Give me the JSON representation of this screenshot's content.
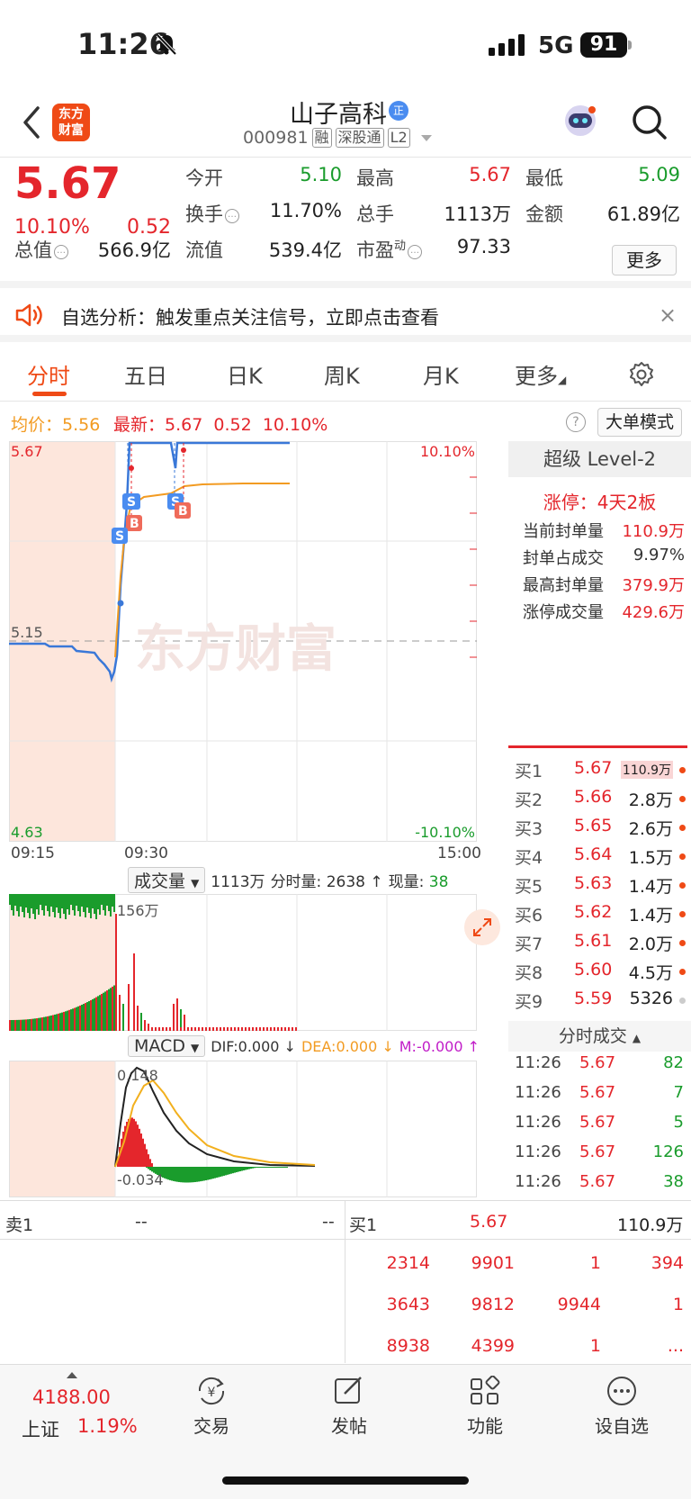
{
  "status": {
    "time": "11:26",
    "network": "5G",
    "battery": "91"
  },
  "header": {
    "logo": [
      "东方",
      "财富"
    ],
    "stock_name": "山子高科",
    "badge": "正",
    "code": "000981",
    "tags": [
      "融",
      "深股通",
      "L2"
    ]
  },
  "quote": {
    "price": "5.67",
    "change_pct": "10.10%",
    "change_amt": "0.52",
    "open_label": "今开",
    "open": "5.10",
    "high_label": "最高",
    "high": "5.67",
    "low_label": "最低",
    "low": "5.09",
    "turnover_label": "换手",
    "turnover": "11.70%",
    "volume_label": "总手",
    "volume": "1113万",
    "amount_label": "金额",
    "amount": "61.89亿",
    "mktcap_label": "总值",
    "mktcap": "566.9亿",
    "float_label": "流值",
    "float": "539.4亿",
    "pe_label": "市盈",
    "pe_sup": "动",
    "pe": "97.33",
    "more": "更多"
  },
  "notice": {
    "text": "自选分析：触发重点关注信号，立即点击查看",
    "close": "×"
  },
  "tabs": [
    "分时",
    "五日",
    "日K",
    "周K",
    "月K",
    "更多"
  ],
  "avg_row": {
    "avg_label": "均价：",
    "avg": "5.56",
    "latest_label": "最新：",
    "latest": "5.67",
    "latest_chg": "0.52",
    "latest_pct": "10.10%",
    "help": "?",
    "bigorder": "大单模式"
  },
  "chart_labels": {
    "top_price": "5.67",
    "top_pct": "10.10%",
    "mid_price": "5.15",
    "bottom_price": "4.63",
    "bottom_pct": "-10.10%",
    "times": [
      "09:15",
      "09:30",
      "15:00"
    ],
    "watermark": "东方财富",
    "marker_s": "S",
    "marker_b": "B"
  },
  "level2": {
    "title": "超级 Level-2",
    "limitup": "涨停：4天2板",
    "rows": [
      {
        "label": "当前封单量",
        "value": "110.9万",
        "color": "#e4262c"
      },
      {
        "label": "封单占成交",
        "value": "9.97%",
        "color": "#222"
      },
      {
        "label": "最高封单量",
        "value": "379.9万",
        "color": "#e4262c"
      },
      {
        "label": "涨停成交量",
        "value": "429.6万",
        "color": "#e4262c"
      }
    ]
  },
  "bids": [
    {
      "label": "买1",
      "price": "5.67",
      "vol": "110.9万"
    },
    {
      "label": "买2",
      "price": "5.66",
      "vol": "2.8万"
    },
    {
      "label": "买3",
      "price": "5.65",
      "vol": "2.6万"
    },
    {
      "label": "买4",
      "price": "5.64",
      "vol": "1.5万"
    },
    {
      "label": "买5",
      "price": "5.63",
      "vol": "1.4万"
    },
    {
      "label": "买6",
      "price": "5.62",
      "vol": "1.4万"
    },
    {
      "label": "买7",
      "price": "5.61",
      "vol": "2.0万"
    },
    {
      "label": "买8",
      "price": "5.60",
      "vol": "4.5万"
    },
    {
      "label": "买9",
      "price": "5.59",
      "vol": "5326"
    }
  ],
  "volume_panel": {
    "select": "成交量",
    "total": "1113万",
    "fenshi_label": "分时量:",
    "fenshi": "2638",
    "current_label": "现量:",
    "current": "38",
    "max_label": "156万"
  },
  "macd_panel": {
    "select": "MACD",
    "dif": "DIF:0.000",
    "dea": "DEA:0.000",
    "m": "M:-0.000",
    "top_label": "0.148",
    "bottom_label": "-0.034"
  },
  "ticks": {
    "title": "分时成交",
    "rows": [
      {
        "time": "11:26",
        "price": "5.67",
        "vol": "82"
      },
      {
        "time": "11:26",
        "price": "5.67",
        "vol": "7"
      },
      {
        "time": "11:26",
        "price": "5.67",
        "vol": "5"
      },
      {
        "time": "11:26",
        "price": "5.67",
        "vol": "126"
      },
      {
        "time": "11:26",
        "price": "5.67",
        "vol": "38"
      }
    ]
  },
  "queue": {
    "sell_label": "卖1",
    "sell_price": "--",
    "sell_vol": "--",
    "buy_label": "买1",
    "buy_price": "5.67",
    "buy_vol": "110.9万",
    "rows": [
      [
        "2314",
        "9901",
        "1",
        "394"
      ],
      [
        "3643",
        "9812",
        "9944",
        "1"
      ],
      [
        "8938",
        "4399",
        "1",
        "..."
      ]
    ]
  },
  "bottom_nav": {
    "index_value": "4188.00",
    "index_name": "上证",
    "index_pct": "1.19%",
    "items": [
      "交易",
      "发帖",
      "功能",
      "设自选"
    ]
  },
  "colors": {
    "up": "#e4262c",
    "down": "#1a9c2c",
    "accent": "#ef4a16",
    "avg_line": "#f29b22",
    "price_line": "#3a78d8"
  }
}
